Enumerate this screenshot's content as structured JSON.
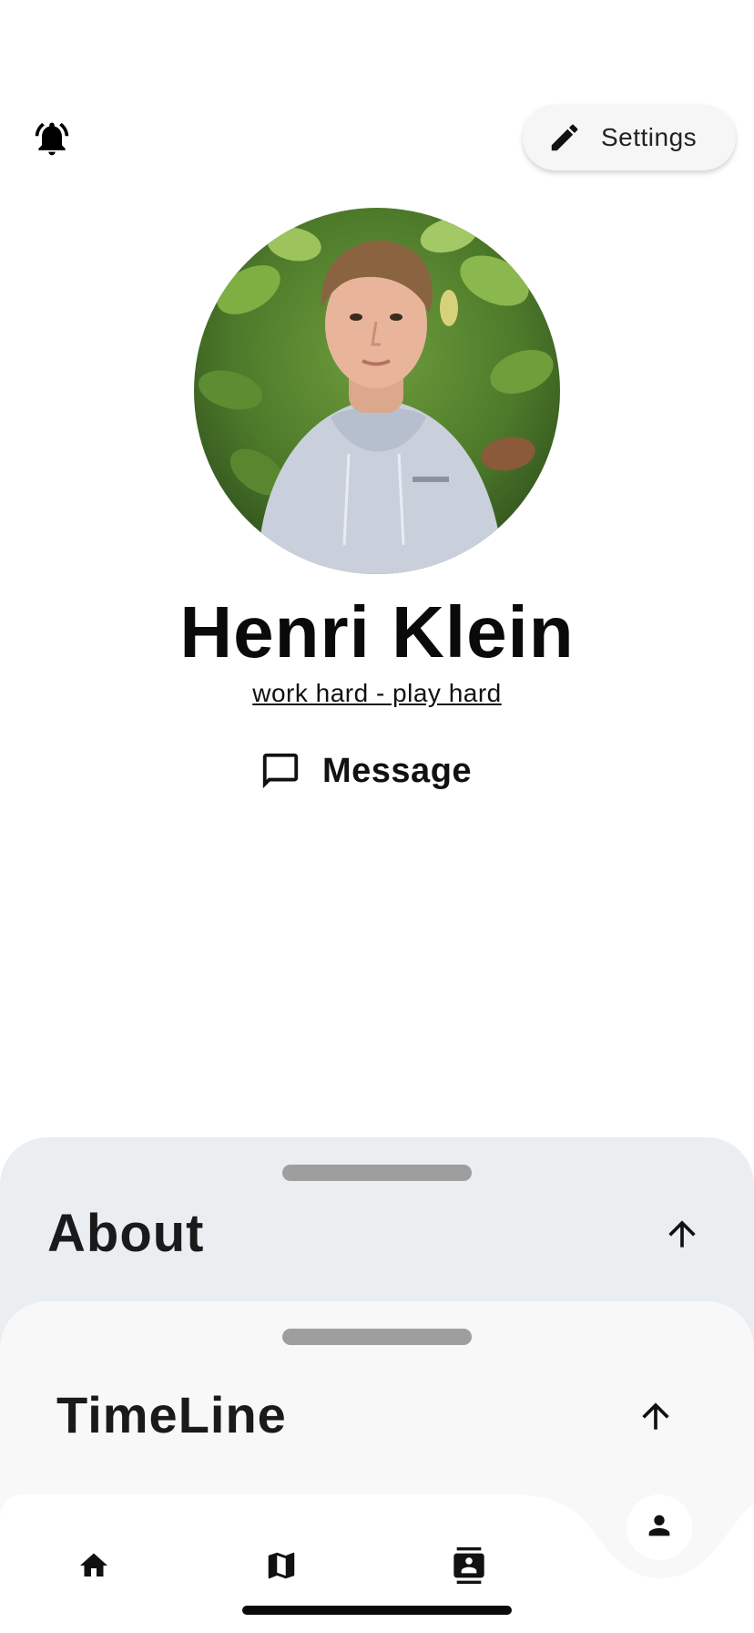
{
  "header": {
    "bell_icon": "notifications-active-icon",
    "settings_label": "Settings",
    "settings_icon": "edit-pencil-icon"
  },
  "profile": {
    "avatar_alt": "profile photo",
    "name": "Henri Klein",
    "motto": "work hard - play hard",
    "message_label": "Message",
    "message_icon": "chat-bubble-icon"
  },
  "sheets": [
    {
      "title": "About",
      "icon": "arrow-up-icon"
    },
    {
      "title": "TimeLine",
      "icon": "arrow-up-icon"
    }
  ],
  "bottom_nav": {
    "items": [
      {
        "icon": "home-icon"
      },
      {
        "icon": "map-icon"
      },
      {
        "icon": "contacts-icon"
      }
    ],
    "active_icon": "person-icon"
  },
  "colors": {
    "about_sheet_bg": "#ebeef1",
    "timeline_sheet_bg": "#f8f8f8",
    "handle": "#9e9e9e",
    "settings_bg": "#f6f6f6"
  }
}
